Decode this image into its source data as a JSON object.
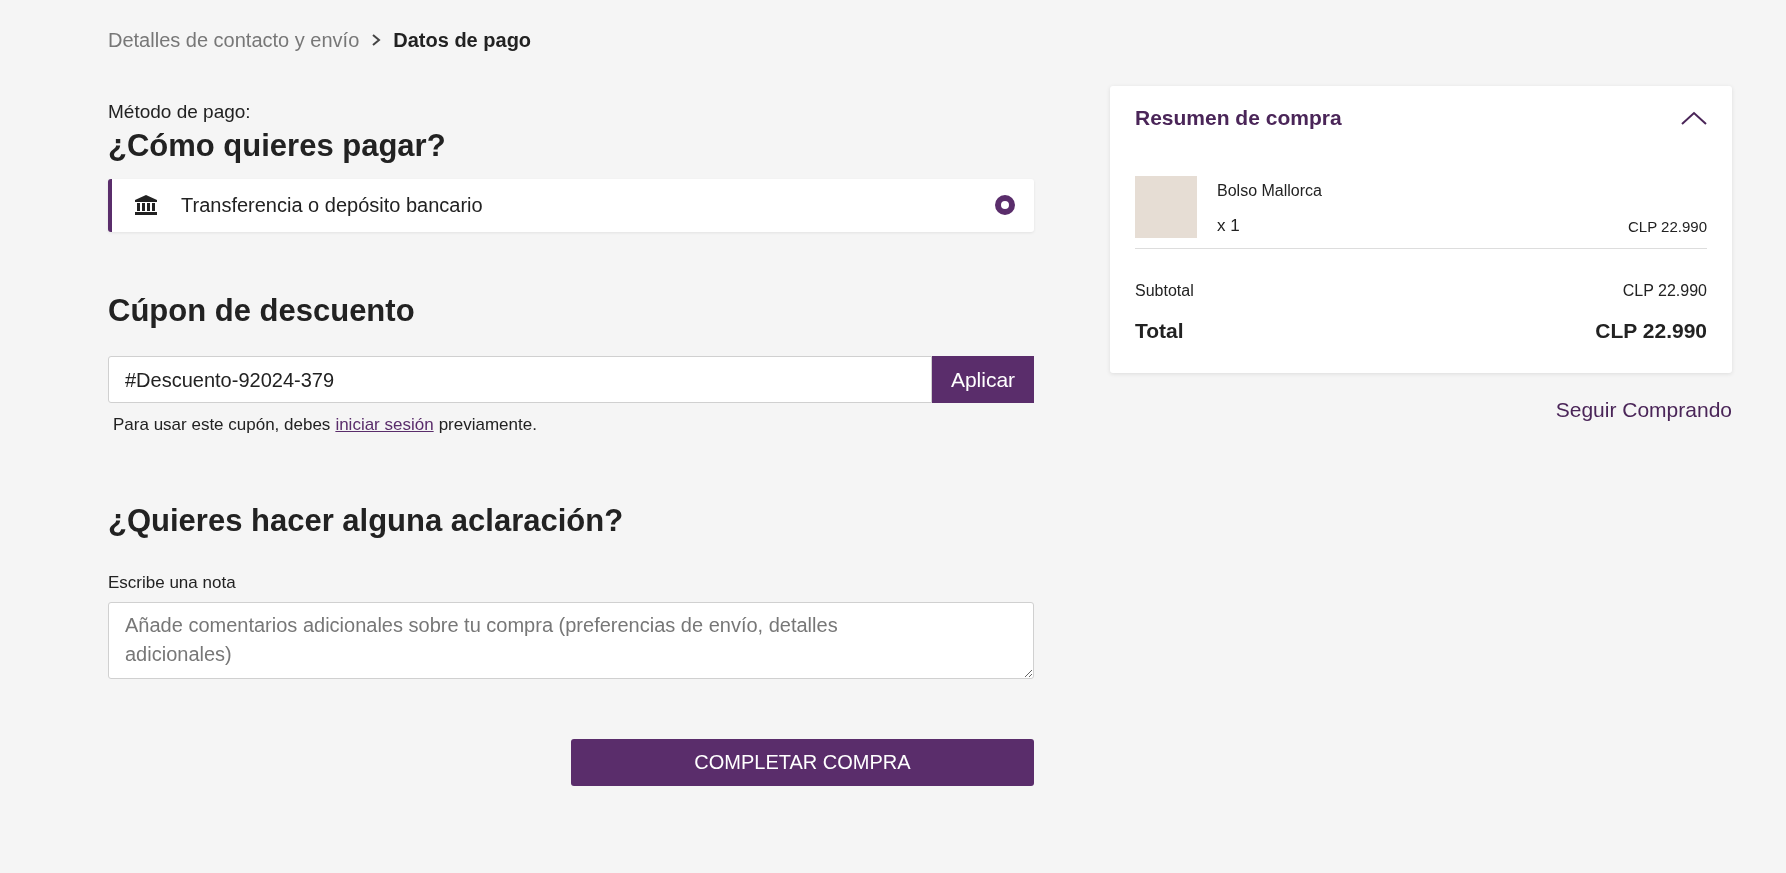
{
  "breadcrumb": [
    {
      "label": "Detalles de contacto y envío",
      "selected": false
    },
    {
      "label": "Datos de pago",
      "selected": true
    }
  ],
  "payment": {
    "label": "Método de pago:",
    "heading": "¿Cómo quieres pagar?",
    "options": [
      {
        "label": "Transferencia o depósito bancario",
        "selected": true
      }
    ]
  },
  "coupon": {
    "heading": "Cúpon de descuento",
    "value": "#Descuento-92024-379",
    "button": "Aplicar",
    "hint_before": "Para usar este cupón, debes",
    "hint_link": "iniciar sesión",
    "hint_after": "previamente."
  },
  "note": {
    "heading": "¿Quieres hacer alguna aclaración?",
    "label": "Escribe una nota",
    "placeholder": "Añade comentarios adicionales sobre tu compra (preferencias de envío, detalles adicionales)"
  },
  "submit": "COMPLETAR COMPRA",
  "summary": {
    "title": "Resumen de compra",
    "expanded": true,
    "items": [
      {
        "name": "Bolso Mallorca",
        "quantity": "x 1",
        "price": "CLP 22.990"
      }
    ],
    "subtotal_label": "Subtotal",
    "subtotal": "CLP 22.990",
    "total_label": "Total",
    "total": "CLP 22.990"
  },
  "continue_link": "Seguir Comprando"
}
